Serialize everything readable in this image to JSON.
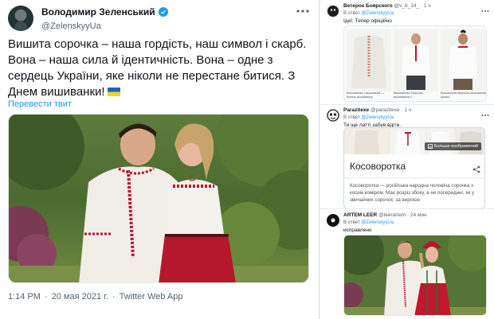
{
  "main_tweet": {
    "author_name": "Володимир Зеленський",
    "handle": "@ZelenskyyUa",
    "text": "Вишита сорочка – наша гордість, наш символ і скарб. Вона – наша сила й ідентичність. Вона – одне з сердець України, яке ніколи не перестане битися. З Днем вишиванки!",
    "translate_link": "Перевести твит",
    "time": "1:14 PM",
    "date": "20 мая 2021 г.",
    "source": "Twitter Web App",
    "separator": "·"
  },
  "replies": [
    {
      "name": "Ветерок Боярского",
      "handle": "@v_b_14_",
      "time": "· 1 ч",
      "reply_prefix": "В ответ",
      "reply_to": "@ZelenskyyUa",
      "text": "Ідеї. Тепер офіційно",
      "products": [
        {
          "caption": "Вышиванки с вышивкой — Купить вышиванку"
        },
        {
          "caption": "Вышиванка Мужская вышиванка с..."
        },
        {
          "caption": "Вышиванка мужская вышиванки купить"
        }
      ]
    },
    {
      "name": "Parazitexe",
      "handle": "@parazitexe",
      "time": "· 1 ч",
      "reply_prefix": "В ответ",
      "reply_to": "@ZelenskyyUa",
      "text": "Ти ще латті забув вдіти.",
      "card": {
        "more_images": "Больше изображений",
        "title": "Косоворотка",
        "description": "Косоворотка — російська народна чоловіча сорочка з косим коміром. Має розріз збоку, а не посередині, як у звичайних сорочок; за версією"
      }
    },
    {
      "name": "ARTEM LEER",
      "handle": "@leerartem",
      "time": "· 24 мин",
      "reply_prefix": "В ответ",
      "reply_to": "@ZelenskyyUa",
      "text": "исправлено"
    }
  ],
  "colors": {
    "accent": "#1d9bf0",
    "text": "#0f1419",
    "muted": "#536471",
    "embroidery_red": "#b5172b"
  },
  "icons": [
    "verified-badge-icon",
    "more-options-icon",
    "ukraine-flag-icon",
    "share-icon",
    "images-icon"
  ]
}
